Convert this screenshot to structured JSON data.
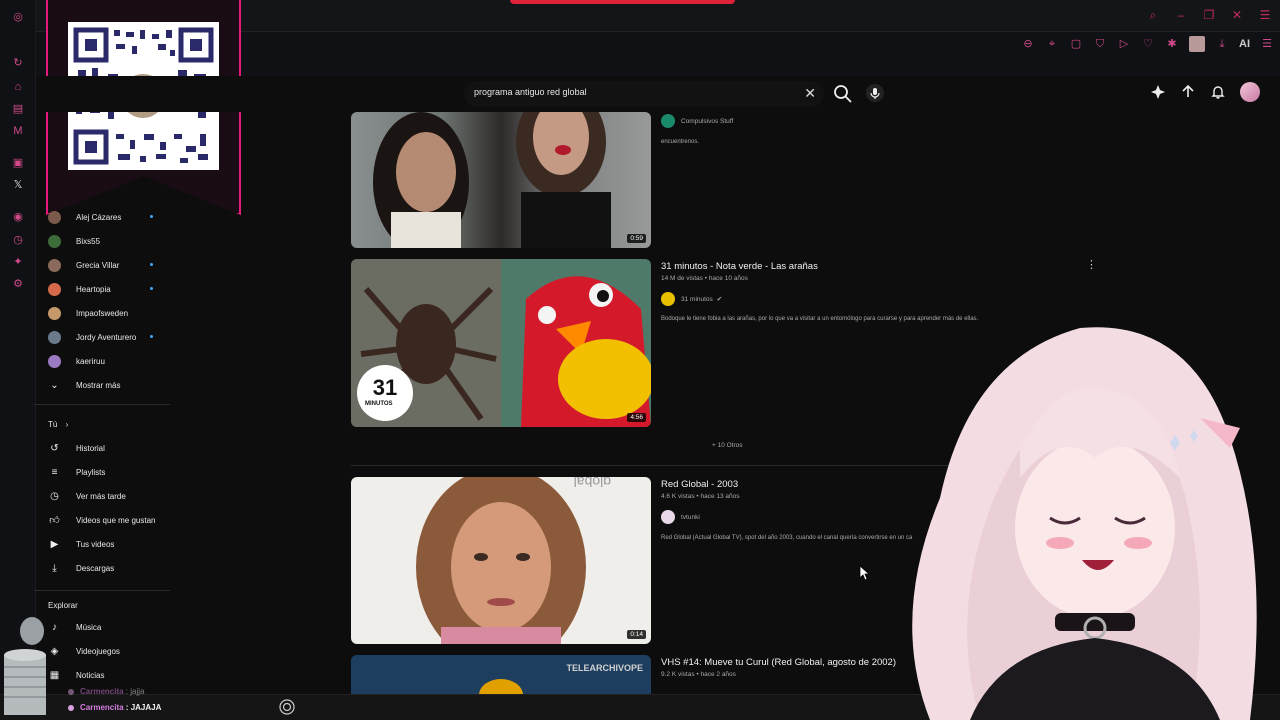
{
  "search": {
    "query": "programa antiguo red global"
  },
  "subscriptions": [
    {
      "name": "Alej Cázares",
      "color": "#7a5a4a",
      "live": true
    },
    {
      "name": "Bixs55",
      "color": "#3e6b3a",
      "live": false
    },
    {
      "name": "Grecia Villar",
      "color": "#8a6a5a",
      "live": true
    },
    {
      "name": "Heartopia",
      "color": "#d46a4a",
      "live": true
    },
    {
      "name": "Impaofsweden",
      "color": "#c49a6a",
      "live": false
    },
    {
      "name": "Jordy Aventurero",
      "color": "#6a7a8a",
      "live": true
    },
    {
      "name": "kaeriruu",
      "color": "#9a7ac0",
      "live": false
    }
  ],
  "nav": {
    "show_more": "Mostrar más",
    "you_heading": "Tú",
    "you_items": [
      {
        "label": "Historial",
        "icon": "history-icon"
      },
      {
        "label": "Playlists",
        "icon": "playlist-icon"
      },
      {
        "label": "Ver más tarde",
        "icon": "clock-icon"
      },
      {
        "label": "Videos que me gustan",
        "icon": "thumbs-up-icon"
      },
      {
        "label": "Tus videos",
        "icon": "video-icon"
      },
      {
        "label": "Descargas",
        "icon": "download-icon"
      }
    ],
    "explore_heading": "Explorar",
    "explore_items": [
      {
        "label": "Música",
        "icon": "music-icon"
      },
      {
        "label": "Videojuegos",
        "icon": "gamepad-icon"
      },
      {
        "label": "Noticias",
        "icon": "news-icon"
      }
    ]
  },
  "results": [
    {
      "channel": "Compulsivos Stuff",
      "description": "encuentrenos.",
      "duration": "0:59"
    },
    {
      "title": "31 minutos - Nota verde - Las arañas",
      "views": "14 M de vistas",
      "age": "hace 10 años",
      "channel": "31 minutos",
      "description": "Bodoque le tiene fobia a las arañas, por lo que va a visitar a un entomólogo para curarse y para aprender más de ellas.",
      "duration": "4:56",
      "logo_text": "MINUTOS"
    },
    {
      "title": "Red Global - 2003",
      "views": "4.6 K vistas",
      "age": "hace 13 años",
      "channel": "tvtunki",
      "description": "Red Global (Actual Global TV), spot del año 2003, cuando el canal quería convertirse en un ca",
      "duration": "0:14"
    },
    {
      "title": "VHS #14: Mueve tu Curul (Red Global, agosto de 2002)",
      "views": "9.2 K vistas",
      "age": "hace 2 años",
      "thumb_text": "TELEARCHIVOPE"
    }
  ],
  "more_label": "+ 10 Otros",
  "chat": [
    {
      "user": "Carmencita",
      "message": "jajja"
    },
    {
      "user": "Carmencita",
      "message": "JAJAJA"
    }
  ],
  "colors": {
    "accent": "#e21a7a",
    "live_dot": "#3ea6ff",
    "chat_user": "#d67fe0"
  }
}
